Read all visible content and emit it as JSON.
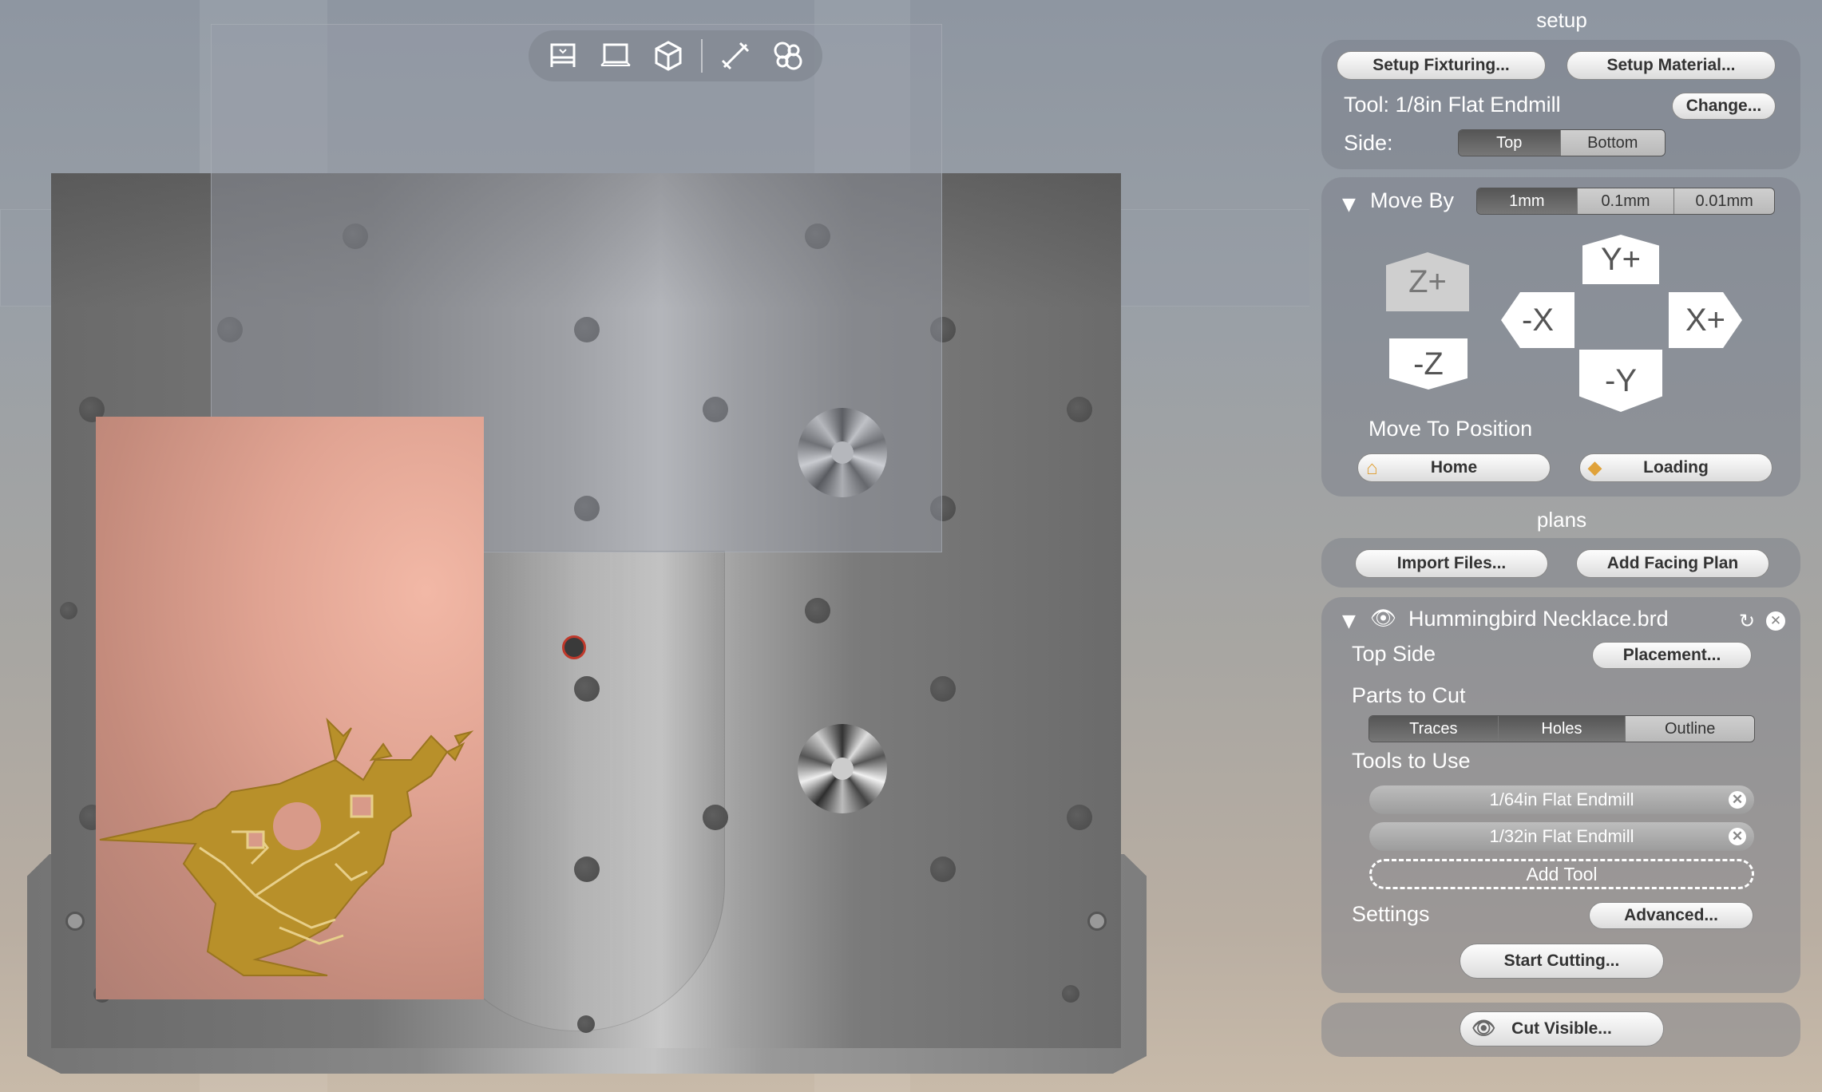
{
  "toolbar": {
    "icons": [
      "top-view-icon",
      "front-view-icon",
      "iso-view-icon",
      "measure-icon",
      "settings-gears-icon"
    ]
  },
  "setup": {
    "heading": "setup",
    "fixturing_button": "Setup Fixturing...",
    "material_button": "Setup Material...",
    "tool_label": "Tool: 1/8in Flat Endmill",
    "change_button": "Change...",
    "side_label": "Side:",
    "side_options": [
      "Top",
      "Bottom"
    ],
    "side_selected": "Top"
  },
  "move": {
    "label": "Move By",
    "step_options": [
      "1mm",
      "0.1mm",
      "0.01mm"
    ],
    "step_selected": "1mm",
    "jog": {
      "z_plus": "Z+",
      "z_minus": "-Z",
      "y_plus": "Y+",
      "y_minus": "-Y",
      "x_plus": "X+",
      "x_minus": "-X"
    },
    "position_label": "Move To Position",
    "home_button": "Home",
    "loading_button": "Loading"
  },
  "plans": {
    "heading": "plans",
    "import_button": "Import Files...",
    "facing_button": "Add Facing Plan",
    "file_name": "Hummingbird Necklace.brd",
    "side_label": "Top Side",
    "placement_button": "Placement...",
    "parts_label": "Parts to Cut",
    "parts_options": [
      "Traces",
      "Holes",
      "Outline"
    ],
    "parts_selected": [
      "Traces",
      "Holes"
    ],
    "tools_label": "Tools to Use",
    "tools": [
      "1/64in Flat Endmill",
      "1/32in Flat Endmill"
    ],
    "add_tool": "Add Tool",
    "settings_label": "Settings",
    "advanced_button": "Advanced...",
    "start_button": "Start Cutting...",
    "cut_visible_button": "Cut Visible..."
  },
  "colors": {
    "accent_dark": "#555555",
    "board_copper": "#d89a89",
    "trace_gold": "#b8902a",
    "marker_red": "#c0392b"
  }
}
